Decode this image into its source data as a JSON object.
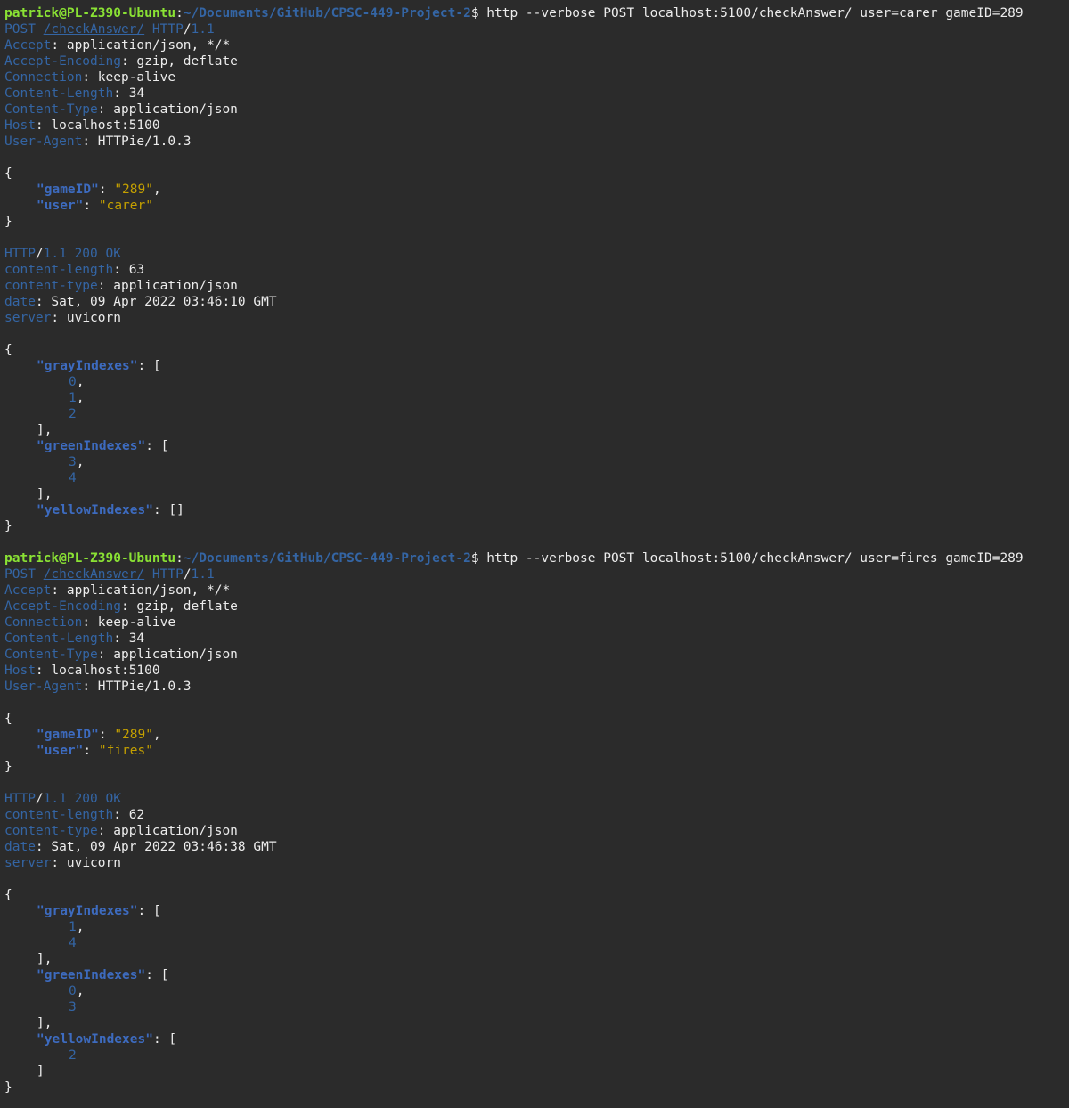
{
  "palette": {
    "background": "#2b2b2b",
    "text": "#ececec",
    "prompt_user": "#8ae234",
    "prompt_path": "#3465a4",
    "header_key": "#3465a4",
    "json_key": "#3d6bbf",
    "json_string": "#c4a000",
    "json_number": "#3465a4"
  },
  "session1": {
    "prompt": {
      "userhost": "patrick@PL-Z390-Ubuntu",
      "colon": ":",
      "path": "~/Documents/GitHub/CPSC-449-Project-2",
      "symbol": "$",
      "command": " http --verbose POST localhost:5100/checkAnswer/ user=carer gameID=289"
    },
    "request": {
      "method": "POST",
      "path": "/checkAnswer/",
      "protocol": "HTTP",
      "slash": "/",
      "version": "1.1",
      "headers": [
        {
          "key": "Accept",
          "value": "application/json, */*"
        },
        {
          "key": "Accept-Encoding",
          "value": "gzip, deflate"
        },
        {
          "key": "Connection",
          "value": "keep-alive"
        },
        {
          "key": "Content-Length",
          "value": "34"
        },
        {
          "key": "Content-Type",
          "value": "application/json"
        },
        {
          "key": "Host",
          "value": "localhost:5100"
        },
        {
          "key": "User-Agent",
          "value": "HTTPie/1.0.3"
        }
      ],
      "body": {
        "gameID_key": "\"gameID\"",
        "gameID_value": "\"289\"",
        "user_key": "\"user\"",
        "user_value": "\"carer\""
      }
    },
    "response": {
      "protocol": "HTTP",
      "slash": "/",
      "status": "1.1 200 OK",
      "headers": [
        {
          "key": "content-length",
          "value": "63"
        },
        {
          "key": "content-type",
          "value": "application/json"
        },
        {
          "key": "date",
          "value": "Sat, 09 Apr 2022 03:46:10 GMT"
        },
        {
          "key": "server",
          "value": "uvicorn"
        }
      ],
      "body": {
        "gray_key": "\"grayIndexes\"",
        "gray": [
          "0",
          "1",
          "2"
        ],
        "green_key": "\"greenIndexes\"",
        "green": [
          "3",
          "4"
        ],
        "yellow_key": "\"yellowIndexes\"",
        "yellow_empty": "[]"
      }
    }
  },
  "session2": {
    "prompt": {
      "userhost": "patrick@PL-Z390-Ubuntu",
      "colon": ":",
      "path": "~/Documents/GitHub/CPSC-449-Project-2",
      "symbol": "$",
      "command": " http --verbose POST localhost:5100/checkAnswer/ user=fires gameID=289"
    },
    "request": {
      "method": "POST",
      "path": "/checkAnswer/",
      "protocol": "HTTP",
      "slash": "/",
      "version": "1.1",
      "headers": [
        {
          "key": "Accept",
          "value": "application/json, */*"
        },
        {
          "key": "Accept-Encoding",
          "value": "gzip, deflate"
        },
        {
          "key": "Connection",
          "value": "keep-alive"
        },
        {
          "key": "Content-Length",
          "value": "34"
        },
        {
          "key": "Content-Type",
          "value": "application/json"
        },
        {
          "key": "Host",
          "value": "localhost:5100"
        },
        {
          "key": "User-Agent",
          "value": "HTTPie/1.0.3"
        }
      ],
      "body": {
        "gameID_key": "\"gameID\"",
        "gameID_value": "\"289\"",
        "user_key": "\"user\"",
        "user_value": "\"fires\""
      }
    },
    "response": {
      "protocol": "HTTP",
      "slash": "/",
      "status": "1.1 200 OK",
      "headers": [
        {
          "key": "content-length",
          "value": "62"
        },
        {
          "key": "content-type",
          "value": "application/json"
        },
        {
          "key": "date",
          "value": "Sat, 09 Apr 2022 03:46:38 GMT"
        },
        {
          "key": "server",
          "value": "uvicorn"
        }
      ],
      "body": {
        "gray_key": "\"grayIndexes\"",
        "gray": [
          "1",
          "4"
        ],
        "green_key": "\"greenIndexes\"",
        "green": [
          "0",
          "3"
        ],
        "yellow_key": "\"yellowIndexes\"",
        "yellow": [
          "2"
        ]
      }
    }
  },
  "punct": {
    "open_brace": "{",
    "close_brace": "}",
    "open_bracket": "[",
    "close_bracket": "]",
    "close_bracket_comma": "],",
    "colon_space": ": ",
    "colon_bracket": ": [",
    "comma": ",",
    "blank": " "
  }
}
